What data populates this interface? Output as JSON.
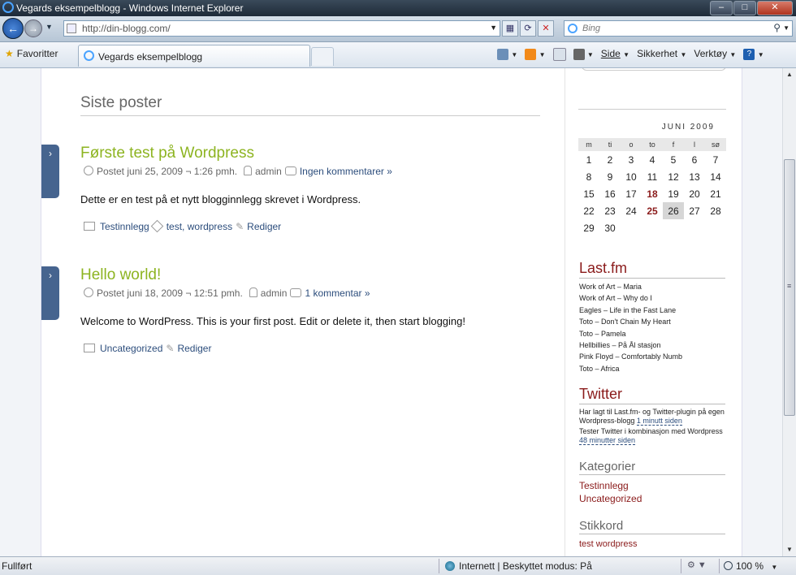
{
  "window": {
    "title": "Vegards eksempelblogg - Windows Internet Explorer"
  },
  "addressbar": {
    "url": "http://din-blogg.com/"
  },
  "search": {
    "placeholder": "Bing"
  },
  "commandbar": {
    "favorites_label": "Favoritter",
    "tab_label": "Vegards eksempelblogg",
    "side_label": "Side",
    "security_label": "Sikkerhet",
    "tools_label": "Verktøy"
  },
  "main": {
    "heading": "Siste poster",
    "posts": [
      {
        "title": "Første test på Wordpress",
        "date": "Postet juni 25, 2009 ¬ 1:26 pmh.",
        "author": "admin",
        "comments": "Ingen kommentarer »",
        "body": "Dette er en test på et nytt blogginnlegg skrevet i Wordpress.",
        "category": "Testinnlegg",
        "tags_text": "test, wordpress",
        "edit": "Rediger"
      },
      {
        "title": "Hello world!",
        "date": "Postet juni 18, 2009 ¬ 12:51 pmh.",
        "author": "admin",
        "comments": "1 kommentar »",
        "body": "Welcome to WordPress. This is your first post. Edit or delete it, then start blogging!",
        "category": "Uncategorized",
        "edit": "Rediger"
      }
    ]
  },
  "sidebar": {
    "calendar": {
      "caption": "JUNI 2009",
      "weekdays": [
        "m",
        "ti",
        "o",
        "to",
        "f",
        "l",
        "sø"
      ],
      "weeks": [
        [
          "1",
          "2",
          "3",
          "4",
          "5",
          "6",
          "7"
        ],
        [
          "8",
          "9",
          "10",
          "11",
          "12",
          "13",
          "14"
        ],
        [
          "15",
          "16",
          "17",
          "18",
          "19",
          "20",
          "21"
        ],
        [
          "22",
          "23",
          "24",
          "25",
          "26",
          "27",
          "28"
        ],
        [
          "29",
          "30",
          "",
          "",
          "",
          "",
          ""
        ]
      ],
      "post_days": [
        "18",
        "25"
      ],
      "today": "26"
    },
    "lastfm": {
      "title": "Last.fm",
      "tracks": [
        "Work of Art – Maria",
        "Work of Art – Why do I",
        "Eagles – Life in the Fast Lane",
        "Toto – Don't Chain My Heart",
        "Toto – Pamela",
        "Hellbillies – På Ål stasjon",
        "Pink Floyd – Comfortably Numb",
        "Toto – Africa"
      ]
    },
    "twitter": {
      "title": "Twitter",
      "tweets": [
        {
          "text": "Har lagt til Last.fm- og Twitter-plugin på egen Wordpress-blogg",
          "ago": "1 minutt siden"
        },
        {
          "text": "Tester Twitter i kombinasjon med Wordpress",
          "ago": "48 minutter siden"
        }
      ]
    },
    "categories": {
      "title": "Kategorier",
      "items": [
        "Testinnlegg",
        "Uncategorized"
      ]
    },
    "tags": {
      "title": "Stikkord",
      "items_text": "test wordpress"
    }
  },
  "statusbar": {
    "status": "Fullført",
    "zone": "Internett | Beskyttet modus: På",
    "zoom": "100 %"
  }
}
